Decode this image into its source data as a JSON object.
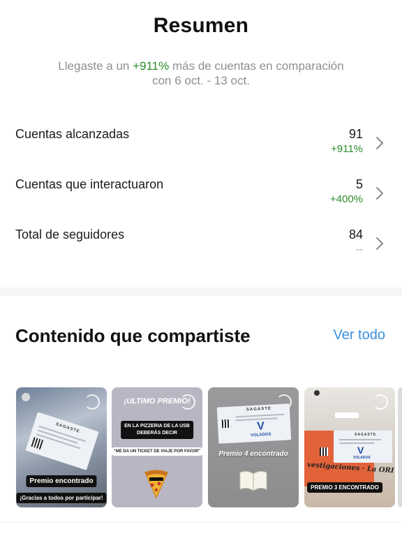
{
  "header": {
    "title": "Resumen"
  },
  "summary": {
    "prefix": "Llegaste a un ",
    "growth": "+911%",
    "suffix": " más de cuentas en comparación",
    "line2": "con 6 oct. - 13 oct."
  },
  "stats": [
    {
      "label": "Cuentas alcanzadas",
      "value": "91",
      "delta": "+911%"
    },
    {
      "label": "Cuentas que interactuaron",
      "value": "5",
      "delta": "+400%"
    },
    {
      "label": "Total de seguidores",
      "value": "84",
      "delta": "--"
    }
  ],
  "content": {
    "title": "Contenido que compartiste",
    "see_all": "Ver todo"
  },
  "thumbnails": [
    {
      "caption": "Premio encontrado",
      "subcaption": "¡Gracias a todos por participar!",
      "ticket_label": "SAGASTE"
    },
    {
      "heading": "¡ULTIMO PREMIO!",
      "line1": "EN LA PIZZERIA DE LA USB",
      "line2": "DEBERÁS DECIR",
      "quote": "\"ME DA UN TICKET DE VIAJE POR FAVOR\""
    },
    {
      "caption": "Premio 4 encontrado",
      "ticket_label": "SAGASTE",
      "brand": "VOLADOS"
    },
    {
      "caption": "PREMIO 3 ENCONTRADO",
      "ticket_label": "SAGASTE",
      "brand": "VOLADOS",
      "banner": "vestigaciones · La ORI"
    }
  ],
  "colors": {
    "accent": "#3a8fe0",
    "positive": "#2e8b2e",
    "muted": "#8e8e8e"
  },
  "icons": {
    "chevron": "chevron-right-icon"
  }
}
